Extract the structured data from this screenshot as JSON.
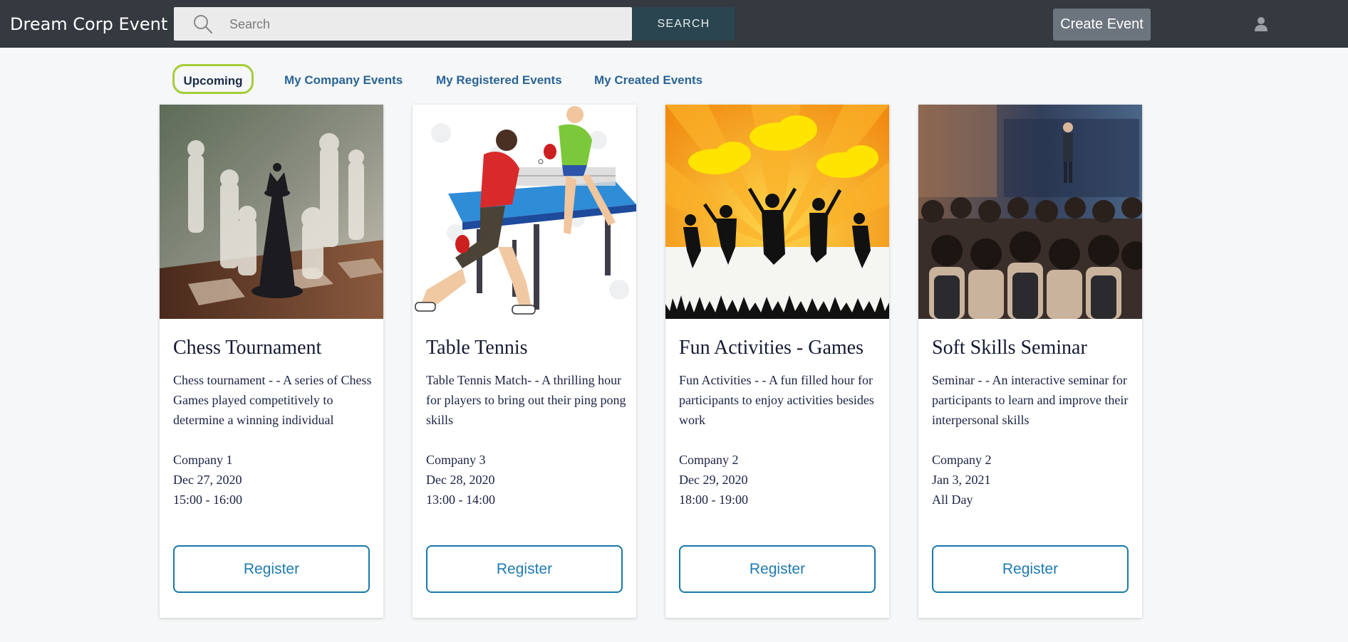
{
  "header": {
    "brand": "Dream Corp Event",
    "search_placeholder": "Search",
    "search_button": "SEARCH",
    "create_button": "Create Event",
    "user_icon": "user-icon",
    "search_icon": "search-icon"
  },
  "tabs": [
    {
      "label": "Upcoming",
      "active": true
    },
    {
      "label": "My Company Events"
    },
    {
      "label": "My Registered Events"
    },
    {
      "label": "My Created Events"
    }
  ],
  "colors": {
    "header_bg": "#343a40",
    "active_tab_border": "#a5cd39",
    "link": "#2a6496",
    "register_border": "#1879a8"
  },
  "events": [
    {
      "title": "Chess Tournament",
      "description": "Chess tournament - - A series of Chess Games played competitively to determine a winning individual",
      "company": "Company 1",
      "date": "Dec 27, 2020",
      "time": "15:00 - 16:00",
      "button": "Register",
      "image": "chess-image"
    },
    {
      "title": "Table Tennis",
      "description": "Table Tennis Match- - A thrilling hour for players to bring out their ping pong skills",
      "company": "Company 3",
      "date": "Dec 28, 2020",
      "time": "13:00 - 14:00",
      "button": "Register",
      "image": "table-tennis-image"
    },
    {
      "title": "Fun Activities - Games",
      "description": "Fun Activities - - A fun filled hour for participants to enjoy activities besides work",
      "company": "Company 2",
      "date": "Dec 29, 2020",
      "time": "18:00 - 19:00",
      "button": "Register",
      "image": "fun-activities-image"
    },
    {
      "title": "Soft Skills Seminar",
      "description": "Seminar - - An interactive seminar for participants to learn and improve their interpersonal skills",
      "company": "Company 2",
      "date": "Jan 3, 2021",
      "time": "All Day",
      "button": "Register",
      "image": "seminar-image"
    }
  ]
}
